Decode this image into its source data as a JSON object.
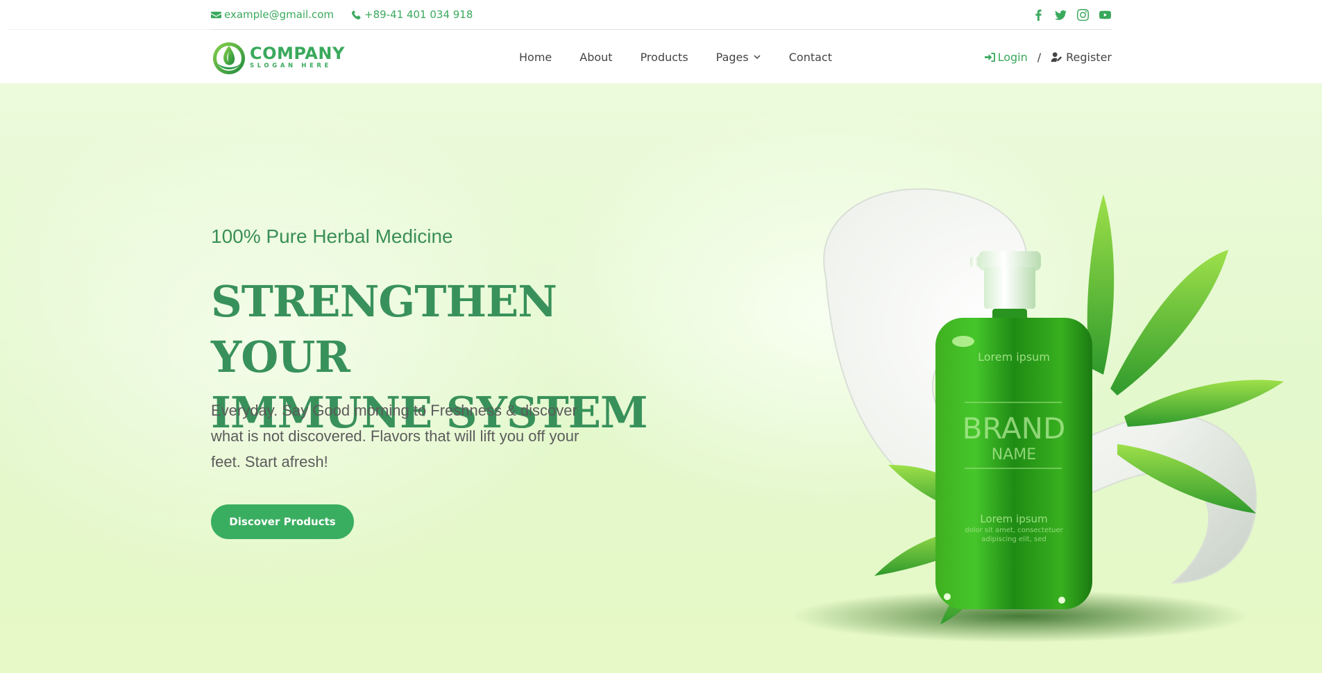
{
  "topbar": {
    "email": "example@gmail.com",
    "phone": "+89-41 401 034 918",
    "email_icon": "envelope-icon",
    "phone_icon": "phone-icon",
    "socials": [
      "facebook-icon",
      "twitter-icon",
      "instagram-icon",
      "youtube-icon"
    ]
  },
  "brand": {
    "name": "COMPANY",
    "slogan": "SLOGAN HERE",
    "color": "#3aa95c"
  },
  "nav": {
    "items": [
      {
        "label": "Home"
      },
      {
        "label": "About"
      },
      {
        "label": "Products"
      },
      {
        "label": "Pages",
        "has_dropdown": true
      },
      {
        "label": "Contact"
      }
    ],
    "login": "Login",
    "separator": "/",
    "register": "Register"
  },
  "hero": {
    "kicker": "100% Pure Herbal Medicine",
    "title_line1": "STRENGTHEN YOUR",
    "title_line2": "IMMUNE SYSTEM",
    "description": "Everyday. Say Good morning to Freshness & discover what is not discovered. Flavors that will lift you off your feet. Start afresh!",
    "cta": "Discover Products",
    "accent": "#3aae60",
    "product": {
      "top_label": "Lorem ipsum",
      "brand": "BRAND",
      "name": "NAME",
      "bottom_label": "Lorem ipsum",
      "small_text_1": "dolor sit amet, consectetuer",
      "small_text_2": "adipiscing elit, sed"
    }
  }
}
